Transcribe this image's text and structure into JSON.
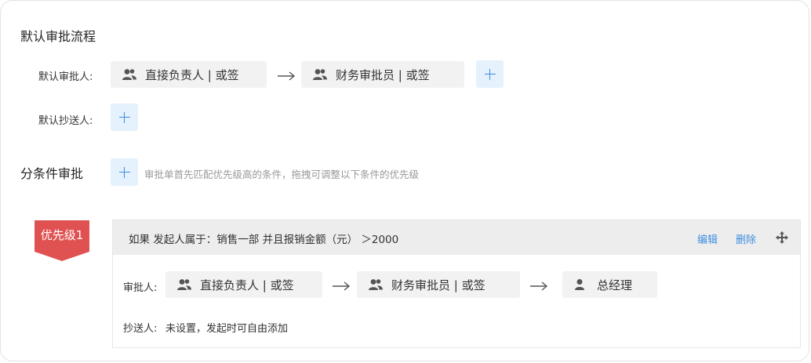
{
  "default_flow": {
    "title": "默认审批流程",
    "approver_label": "默认审批人:",
    "approvers": [
      {
        "label": "直接负责人 | 或签",
        "icon": "group-icon"
      },
      {
        "label": "财务审批员 | 或签",
        "icon": "group-icon"
      }
    ],
    "cc_label": "默认抄送人:"
  },
  "conditional": {
    "title": "分条件审批",
    "hint": "审批单首先匹配优先级高的条件，拖拽可调整以下条件的优先级",
    "rules": [
      {
        "priority_label": "优先级1",
        "condition": "如果 发起人属于：销售一部 并且报销金额（元） ＞2000",
        "edit_label": "编辑",
        "delete_label": "删除",
        "approver_label": "审批人:",
        "approvers": [
          {
            "label": "直接负责人 | 或签",
            "icon": "group-icon"
          },
          {
            "label": "财务审批员 | 或签",
            "icon": "group-icon"
          },
          {
            "label": "总经理",
            "icon": "person-icon"
          }
        ],
        "cc_label": "抄送人:",
        "cc_value": "未设置，发起时可自由添加"
      }
    ]
  },
  "colors": {
    "accent": "#3d8fe0",
    "priority_tag": "#e05252",
    "chip_bg": "#f2f2f2",
    "add_bg": "#e5f1fc"
  }
}
